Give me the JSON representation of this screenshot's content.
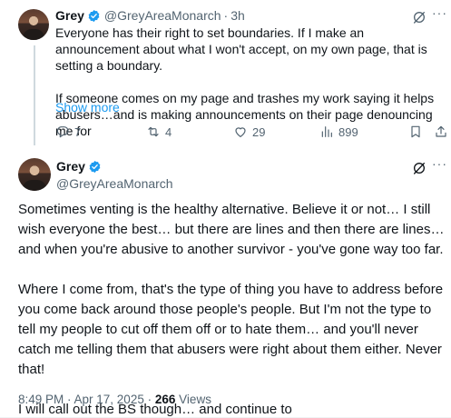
{
  "parent_tweet": {
    "author_name": "Grey",
    "author_handle": "@GreyAreaMonarch",
    "separator": "·",
    "time": "3h",
    "paragraph_1": "Everyone has their right to set boundaries. If I make an announcement about what I won't accept, on my own page, that is setting a boundary.",
    "paragraph_2": "If someone comes on my page and trashes my work saying it helps abusers…and is making announcements on their page denouncing me for",
    "show_more": "Show more",
    "stats": {
      "replies": "7",
      "reposts": "4",
      "likes": "29",
      "views": "899"
    }
  },
  "main_tweet": {
    "author_name": "Grey",
    "author_handle": "@GreyAreaMonarch",
    "paragraph_1": "Sometimes venting is the healthy alternative. Believe it or not… I still wish everyone the best… but there are lines and then there are lines… and when you're abusive to another survivor - you've gone way too far.",
    "paragraph_2": "Where I come from, that's the type of thing you have to address before you come back around those people's people. But I'm not the type to tell my people to cut off them off or to hate them… and you'll never catch me telling them that abusers were right about them either. Never that!",
    "paragraph_3": "I will call out the BS though… and continue to",
    "timestamp": "8:49 PM · Apr 17, 2025",
    "meta_separator": "·",
    "views_count": "266",
    "views_label": "Views"
  },
  "icons": {
    "verified": "verified-badge-icon",
    "grok": "grok-icon",
    "more": "more-icon",
    "reply": "reply-icon",
    "repost": "repost-icon",
    "like": "heart-icon",
    "views": "views-icon",
    "bookmark": "bookmark-icon",
    "share": "share-icon"
  },
  "colors": {
    "accent": "#1d9bf0",
    "text": "#0f1419",
    "muted": "#536471",
    "thread_line": "#cfd9de"
  }
}
